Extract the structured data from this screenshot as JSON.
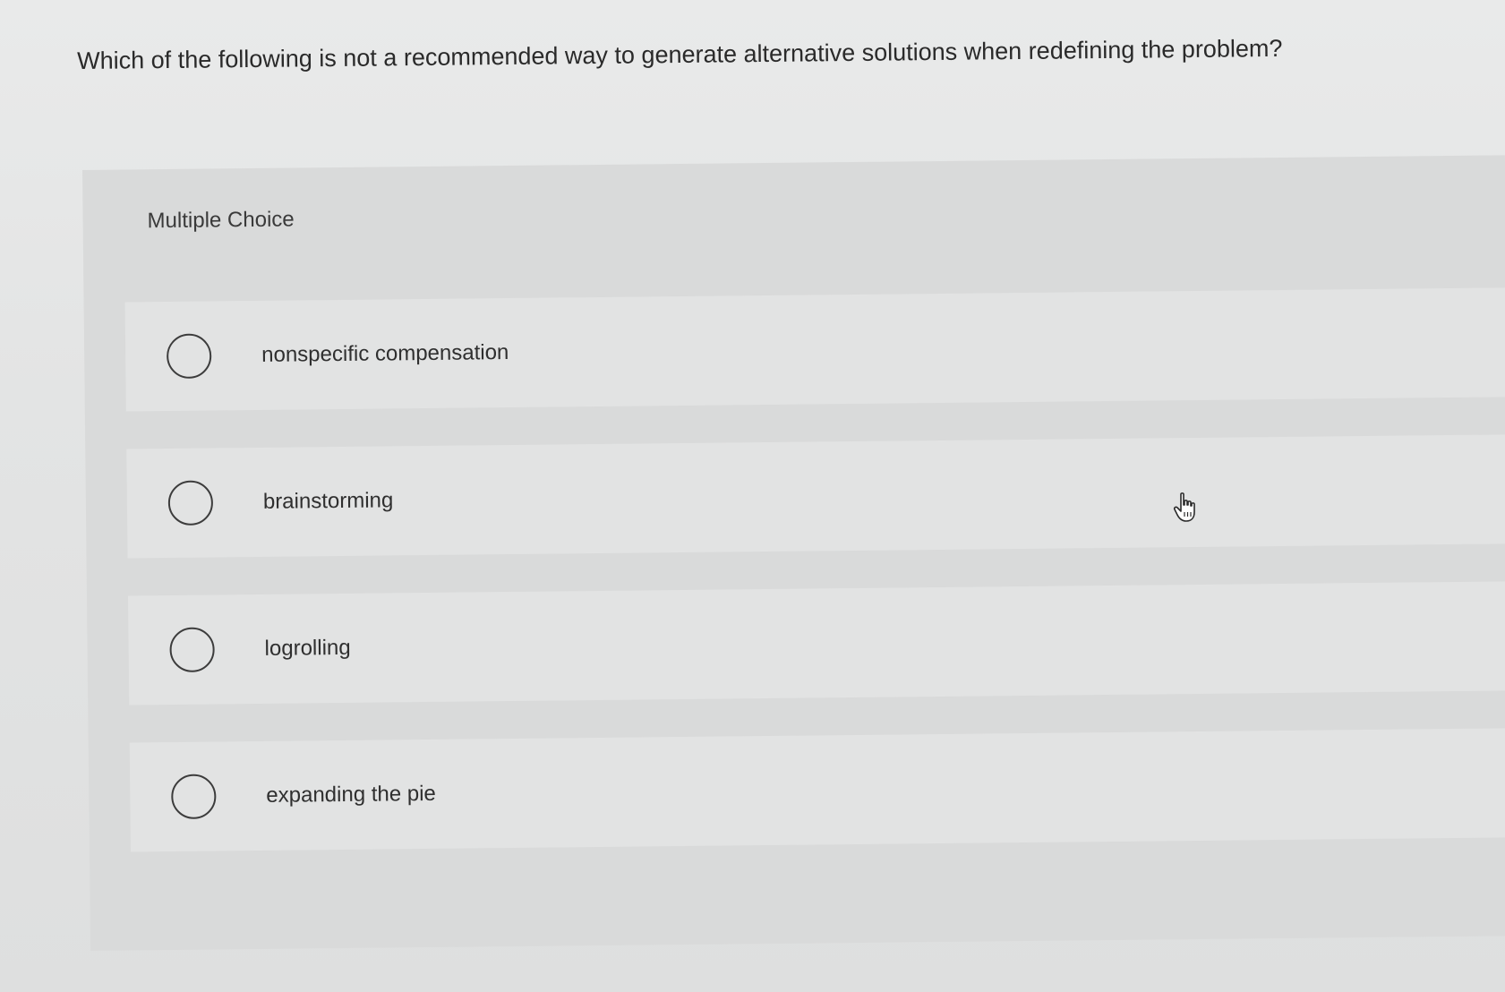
{
  "question": {
    "text": "Which of the following is not a recommended way to generate alternative solutions when redefining the problem?"
  },
  "answer_section": {
    "type_label": "Multiple Choice",
    "options": [
      {
        "label": "nonspecific compensation",
        "selected": false
      },
      {
        "label": "brainstorming",
        "selected": false
      },
      {
        "label": "logrolling",
        "selected": false
      },
      {
        "label": "expanding the pie",
        "selected": false
      }
    ]
  },
  "cursor": {
    "icon": "hand-pointer-icon"
  },
  "colors": {
    "background": "#e4e5e5",
    "panel": "#d9dada",
    "option_row": "#e2e3e3",
    "text": "#2b2b2b"
  }
}
